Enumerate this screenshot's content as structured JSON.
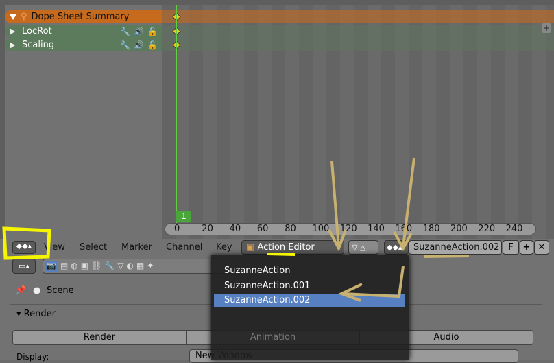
{
  "channels": {
    "summary": "Dope Sheet Summary",
    "items": [
      "LocRot",
      "Scaling"
    ]
  },
  "timeline": {
    "current_frame": "1",
    "ticks": [
      "0",
      "20",
      "40",
      "60",
      "80",
      "100",
      "120",
      "140",
      "160",
      "180",
      "200",
      "220",
      "240"
    ]
  },
  "header": {
    "menus": [
      "View",
      "Select",
      "Marker",
      "Channel",
      "Key"
    ],
    "mode": "Action Editor",
    "action_name": "SuzanneAction.002",
    "fake_user": "F"
  },
  "dropdown": {
    "items": [
      "SuzanneAction",
      "SuzanneAction.001",
      "SuzanneAction.002"
    ],
    "selected": "SuzanneAction.002"
  },
  "properties": {
    "context": "Scene",
    "panel": "Render",
    "buttons": [
      "Render",
      "Animation",
      "Audio"
    ],
    "display_label": "Display:",
    "display_value": "New Window"
  },
  "colors": {
    "summary": "#c66a1e",
    "channel": "#5c7a5c",
    "selection": "#5680c2",
    "annotation_yellow": "#f5f500",
    "annotation_tan": "#c8b070"
  }
}
